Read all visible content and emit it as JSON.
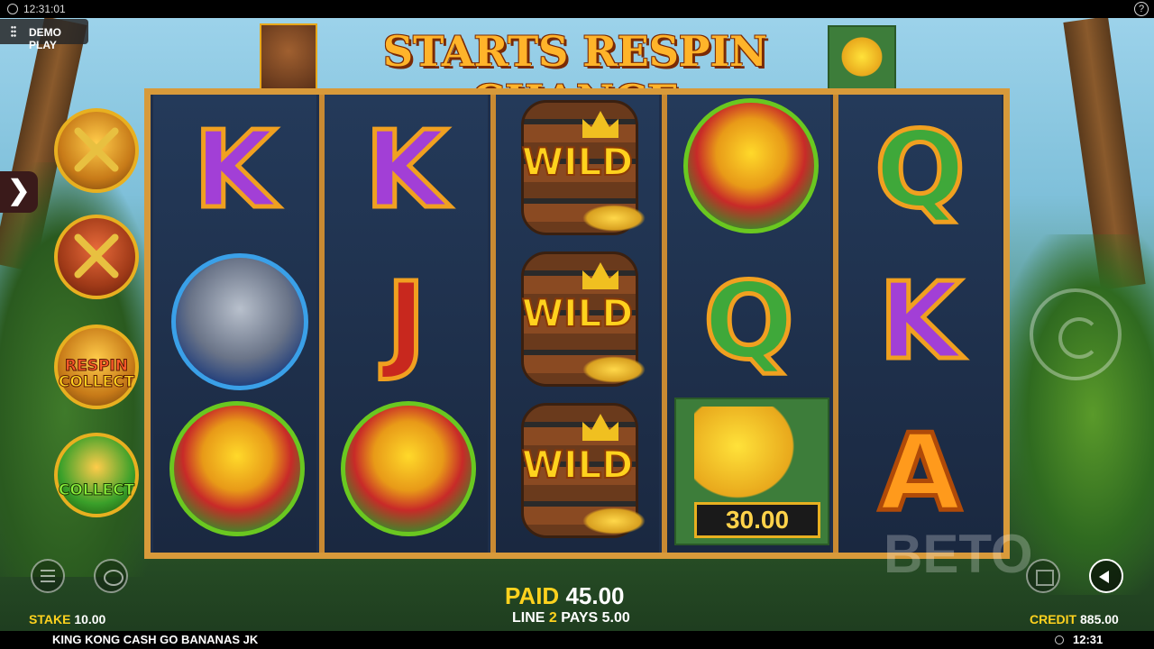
{
  "top_bar": {
    "time": "12:31:01",
    "help_icon": "?"
  },
  "demo": {
    "label": "DEMO PLAY"
  },
  "side_arrow": {
    "glyph": "❯"
  },
  "banner": {
    "text": "STARTS RESPIN CHANCE"
  },
  "features": [
    {
      "name": "kong-chained",
      "label": ""
    },
    {
      "name": "kong-red-chained",
      "label": ""
    },
    {
      "name": "respin-collect",
      "label_line1": "RESPIN",
      "label_line2": "COLLECT"
    },
    {
      "name": "collect",
      "label": "COLLECT"
    }
  ],
  "reels": [
    [
      "K",
      "rhino",
      "parrot"
    ],
    [
      "K",
      "J",
      "parrot"
    ],
    [
      "WILD",
      "WILD",
      "WILD"
    ],
    [
      "parrot",
      "Q",
      "banana"
    ],
    [
      "Q",
      "K",
      "A"
    ]
  ],
  "symbols": {
    "K": "K",
    "Q": "Q",
    "J": "J",
    "A": "A",
    "wild": "WILD"
  },
  "banana_value": "30.00",
  "win": {
    "paid_label": "PAID",
    "paid_value": "45.00",
    "line_label": "LINE",
    "line_number": "2",
    "pays_label": "PAYS",
    "pays_value": "5.00"
  },
  "stake": {
    "label": "STAKE",
    "value": "10.00"
  },
  "credit": {
    "label": "CREDIT",
    "value": "885.00"
  },
  "footer": {
    "game_name": "KING KONG CASH GO BANANAS JK",
    "time": "12:31"
  },
  "watermark": "BETO",
  "colors": {
    "frame": "#d89a3a",
    "accent_yellow": "#ffd21e",
    "banner_orange": "#ffb42a"
  }
}
